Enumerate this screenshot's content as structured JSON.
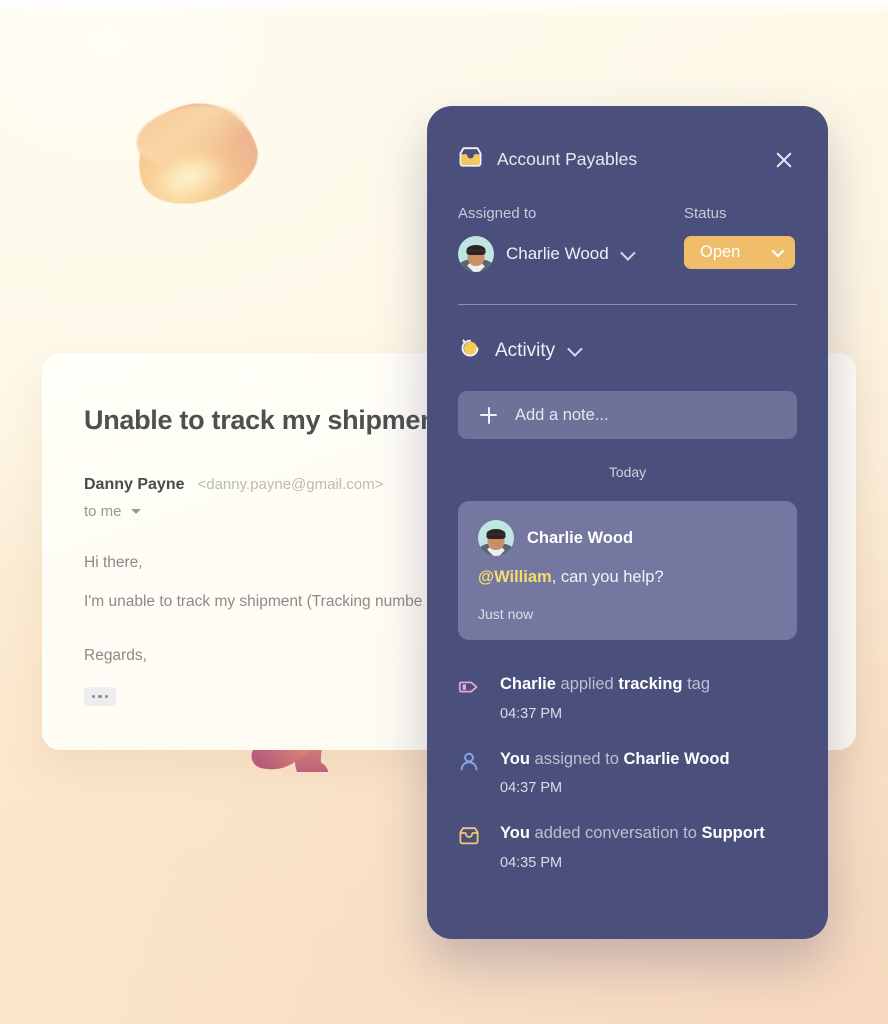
{
  "background": {
    "top_color": "#FEFBEE",
    "bottom_color": "#F6DCC1"
  },
  "decorations": [
    {
      "name": "dome-shape",
      "colors": [
        "#FBE0A8",
        "#EEB492"
      ]
    },
    {
      "name": "squiggle-shape",
      "colors": [
        "#B6567A",
        "#F5C266",
        "#F7D98C"
      ]
    }
  ],
  "email_card": {
    "subject": "Unable to track my shipment",
    "sender_name": "Danny Payne",
    "sender_address": "<danny.payne@gmail.com>",
    "recipient": "to me",
    "body_lines": [
      "Hi there,",
      "I'm unable to track my shipment (Tracking numbe"
    ],
    "closing": "Regards,",
    "expand_label": "..."
  },
  "panel": {
    "inbox_icon": "inbox-icon",
    "title": "Account Payables",
    "close_icon": "close-icon",
    "assigned": {
      "label": "Assigned to",
      "name": "Charlie Wood",
      "chevron_icon": "chevron-down-icon",
      "avatar": "avatar-charlie-wood"
    },
    "status": {
      "label": "Status",
      "value": "Open",
      "color": "#F0BE6B",
      "chevron_icon": "chevron-down-icon"
    },
    "activity": {
      "icon": "activity-history-icon",
      "title": "Activity",
      "chevron_icon": "chevron-down-icon",
      "note_input": {
        "plus_icon": "plus-icon",
        "placeholder": "Add a note..."
      },
      "day_divider": "Today",
      "note": {
        "author": "Charlie Wood",
        "mention": "@William",
        "message_rest": ", can you help?",
        "time": "Just now",
        "mention_color": "#F3DE6E"
      },
      "log": [
        {
          "icon": "tag-icon",
          "icon_color": "#E6A8D2",
          "actor": "Charlie",
          "verb": " applied ",
          "target": "tracking",
          "suffix": " tag",
          "time": "04:37 PM"
        },
        {
          "icon": "user-icon",
          "icon_color": "#8FA8E8",
          "actor": "You",
          "verb": " assigned to ",
          "target": "Charlie Wood",
          "suffix": "",
          "time": "04:37 PM"
        },
        {
          "icon": "inbox-icon",
          "icon_color": "#F0C978",
          "actor": "You",
          "verb": " added conversation to ",
          "target": "Support",
          "suffix": "",
          "time": "04:35 PM"
        }
      ]
    }
  }
}
